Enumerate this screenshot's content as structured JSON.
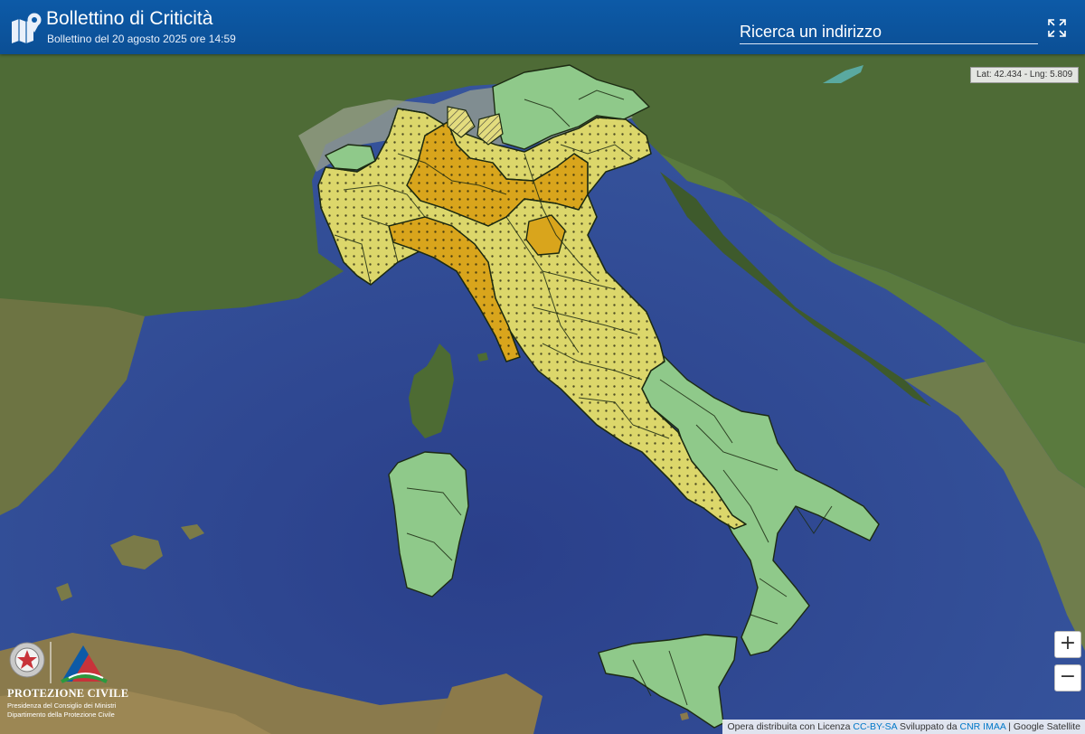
{
  "header": {
    "title": "Bollettino di Criticità",
    "subtitle": "Bollettino del 20 agosto 2025 ore 14:59",
    "icon": "map-pin-icon"
  },
  "search": {
    "placeholder": "Ricerca un indirizzo",
    "value": ""
  },
  "controls": {
    "fullscreen_icon": "fullscreen-icon",
    "zoom_in_label": "+",
    "zoom_out_label": "−"
  },
  "coordinates": {
    "label": "Lat: 42.434 - Lng: 5.809"
  },
  "attribution": {
    "text_prefix": "Opera distribuita con Licenza",
    "license": "CC-BY-SA",
    "text_middle": "Sviluppato da",
    "developer": "CNR IMAA",
    "separator": "|",
    "basemap": "Google Satellite"
  },
  "logo": {
    "line1": "PROTEZIONE CIVILE",
    "line2": "Presidenza del Consiglio dei Ministri",
    "line3": "Dipartimento della Protezione Civile"
  },
  "legend_colors": {
    "green": "#8fc98a",
    "yellow": "#dcd76b",
    "orange": "#d9a51c",
    "sea": "#2f4f9a",
    "header": "#0d5aa7"
  }
}
